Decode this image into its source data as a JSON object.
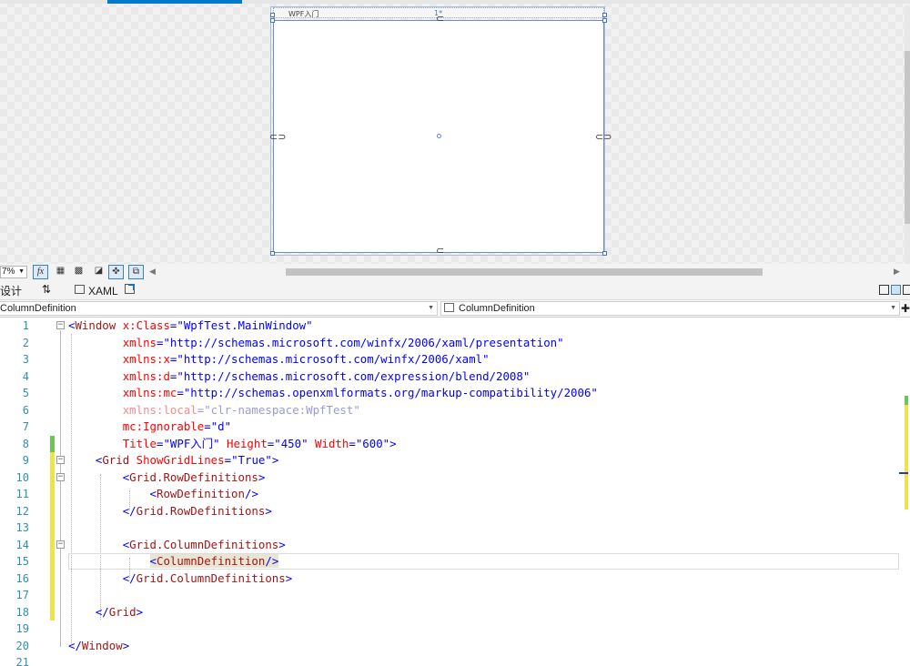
{
  "designer": {
    "window_title": "WPF入门",
    "resize_hint": "1*"
  },
  "toolbar": {
    "zoom": "7%",
    "fx_label": "fx"
  },
  "tabs": {
    "design": "设计",
    "swap": "⇅",
    "xaml": "XAML"
  },
  "navbar": {
    "left_value": "ColumnDefinition",
    "right_value": "ColumnDefinition"
  },
  "colors": {
    "accent": "#007acc",
    "line_number": "#2b91af",
    "tag": "#a31515",
    "attribute": "#ff0000",
    "string": "#0000ff",
    "change_saved": "#6cc55a",
    "change_unsaved": "#efe34b"
  },
  "code": {
    "line_numbers": [
      "1",
      "2",
      "3",
      "4",
      "5",
      "6",
      "7",
      "8",
      "9",
      "10",
      "11",
      "12",
      "13",
      "14",
      "15",
      "16",
      "17",
      "18",
      "19",
      "20",
      "21"
    ],
    "l1": {
      "open": "<",
      "tag": "Window",
      "attr": "x:Class",
      "eq": "=",
      "val": "\"WpfTest.MainWindow\""
    },
    "l2": {
      "attr": "xmlns",
      "eq": "=",
      "val": "\"http://schemas.microsoft.com/winfx/2006/xaml/presentation\""
    },
    "l3": {
      "attr": "xmlns:x",
      "eq": "=",
      "val": "\"http://schemas.microsoft.com/winfx/2006/xaml\""
    },
    "l4": {
      "attr": "xmlns:d",
      "eq": "=",
      "val": "\"http://schemas.microsoft.com/expression/blend/2008\""
    },
    "l5": {
      "attr": "xmlns:mc",
      "eq": "=",
      "val": "\"http://schemas.openxmlformats.org/markup-compatibility/2006\""
    },
    "l6": {
      "attr": "xmlns:local",
      "eq": "=",
      "val": "\"clr-namespace:WpfTest\""
    },
    "l7": {
      "attr": "mc:Ignorable",
      "eq": "=",
      "val": "\"d\""
    },
    "l8": {
      "attr1": "Title",
      "eq1": "=",
      "val1": "\"WPF入门\"",
      "attr2": "Height",
      "eq2": "=",
      "val2": "\"450\"",
      "attr3": "Width",
      "eq3": "=",
      "val3": "\"600\"",
      "close": ">"
    },
    "l9": {
      "open": "<",
      "tag": "Grid",
      "attr": "ShowGridLines",
      "eq": "=",
      "val": "\"True\"",
      "close": ">"
    },
    "l10": {
      "open": "<",
      "tag": "Grid.RowDefinitions",
      "close": ">"
    },
    "l11": {
      "open": "<",
      "tag": "RowDefinition",
      "close": "/>"
    },
    "l12": {
      "open": "</",
      "tag": "Grid.RowDefinitions",
      "close": ">"
    },
    "l14": {
      "open": "<",
      "tag": "Grid.ColumnDefinitions",
      "close": ">"
    },
    "l15": {
      "open": "<",
      "tag": "ColumnDefinition",
      "close": "/>"
    },
    "l16": {
      "open": "</",
      "tag": "Grid.ColumnDefinitions",
      "close": ">"
    },
    "l18": {
      "open": "</",
      "tag": "Grid",
      "close": ">"
    },
    "l20": {
      "open": "</",
      "tag": "Window",
      "close": ">"
    }
  }
}
